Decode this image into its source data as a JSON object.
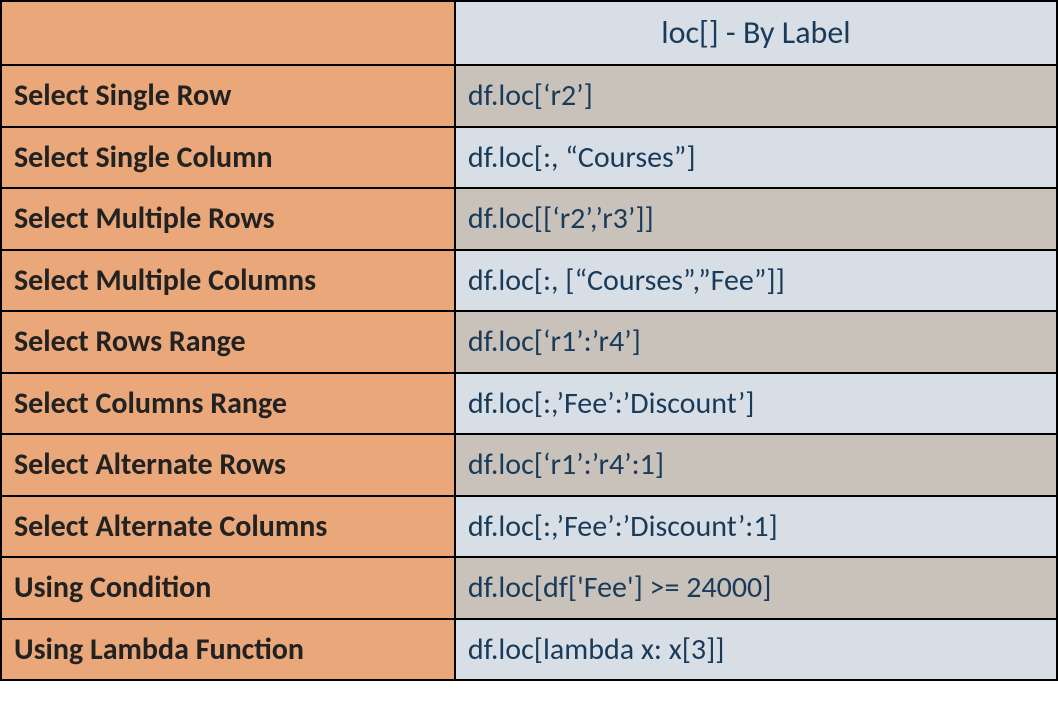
{
  "header": {
    "left": "",
    "right": "loc[] - By Label"
  },
  "rows": [
    {
      "label": "Select Single Row",
      "code": "df.loc[‘r2’]"
    },
    {
      "label": "Select Single Column",
      "code": "df.loc[:, “Courses”]"
    },
    {
      "label": "Select Multiple Rows",
      "code": "df.loc[[‘r2’,’r3’]]"
    },
    {
      "label": "Select Multiple Columns",
      "code": "df.loc[:, [“Courses”,”Fee”]]"
    },
    {
      "label": "Select Rows Range",
      "code": "df.loc[‘r1’:’r4’]"
    },
    {
      "label": "Select Columns Range",
      "code": "df.loc[:,’Fee’:’Discount’]"
    },
    {
      "label": "Select Alternate Rows",
      "code": "df.loc[‘r1’:’r4’:1]"
    },
    {
      "label": "Select Alternate Columns",
      "code": "df.loc[:,’Fee’:’Discount’:1]"
    },
    {
      "label": "Using Condition",
      "code": "df.loc[df['Fee'] >= 24000]"
    },
    {
      "label": "Using Lambda Function",
      "code": "df.loc[lambda x: x[3]]"
    }
  ]
}
